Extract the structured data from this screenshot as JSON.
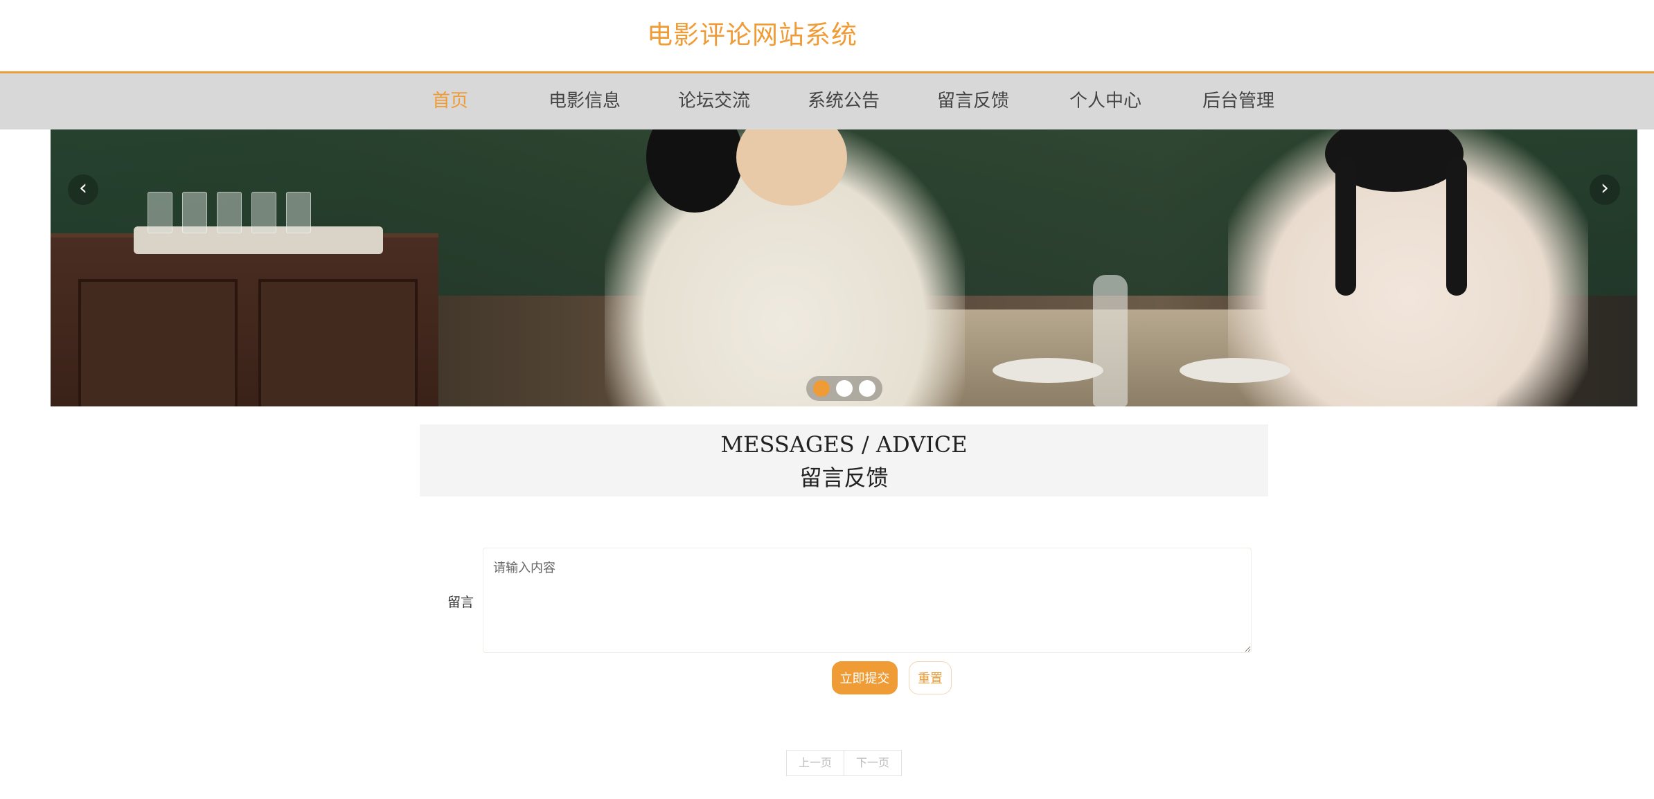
{
  "site": {
    "title": "电影评论网站系统",
    "accent_color": "#ef9b36"
  },
  "nav": {
    "items": [
      {
        "label": "首页",
        "active": true
      },
      {
        "label": "电影信息",
        "active": false
      },
      {
        "label": "论坛交流",
        "active": false
      },
      {
        "label": "系统公告",
        "active": false
      },
      {
        "label": "留言反馈",
        "active": false
      },
      {
        "label": "个人中心",
        "active": false
      },
      {
        "label": "后台管理",
        "active": false
      }
    ]
  },
  "banner": {
    "prev_icon": "chevron-left-icon",
    "next_icon": "chevron-right-icon",
    "prev_glyph": "‹",
    "next_glyph": "›",
    "slide_count": 3,
    "active_slide": 1
  },
  "section": {
    "title_en": "MESSAGES / ADVICE",
    "title_zh": "留言反馈"
  },
  "form": {
    "message_label": "留言",
    "message_placeholder": "请输入内容",
    "message_value": "",
    "submit_label": "立即提交",
    "reset_label": "重置"
  },
  "pagination": {
    "prev_label": "上一页",
    "next_label": "下一页"
  }
}
